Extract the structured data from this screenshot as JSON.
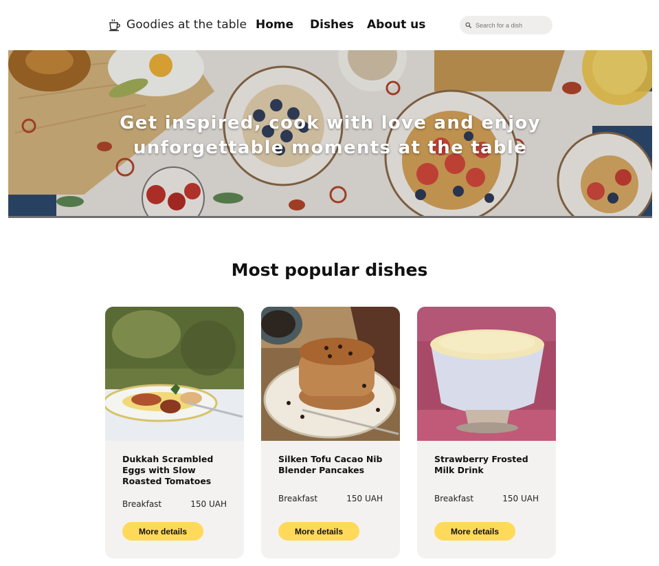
{
  "header": {
    "brand": "Goodies at the table",
    "nav": [
      "Home",
      "Dishes",
      "About us"
    ],
    "search_placeholder": "Search for a dish"
  },
  "hero": {
    "line1": "Get inspired, cook with love and enjoy",
    "line2": "unforgettable moments at the table"
  },
  "popular": {
    "title": "Most popular dishes",
    "cards": [
      {
        "name": "Dukkah Scrambled Eggs with Slow Roasted Tomatoes",
        "category": "Breakfast",
        "price": "150 UAH",
        "button": "More details"
      },
      {
        "name": "Silken Tofu Cacao Nib Blender Pancakes",
        "category": "Breakfast",
        "price": "150 UAH",
        "button": "More details"
      },
      {
        "name": "Strawberry Frosted Milk Drink",
        "category": "Breakfast",
        "price": "150 UAH",
        "button": "More details"
      }
    ]
  },
  "colors": {
    "accent_button": "#ffd95a",
    "card_bg": "#f4f2f0",
    "search_bg": "#efeeec"
  },
  "icons": {
    "brand": "coffee-cup-icon",
    "search": "search-icon"
  }
}
